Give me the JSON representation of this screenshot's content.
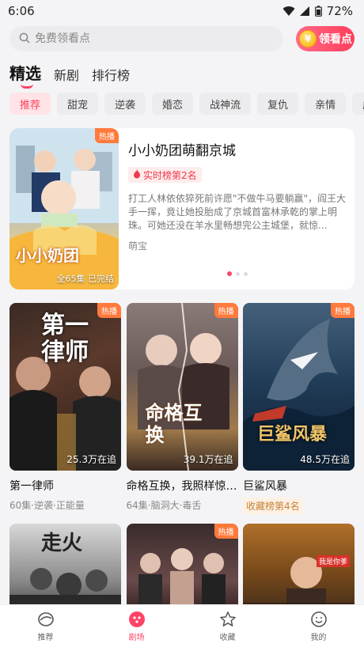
{
  "status_bar": {
    "time": "6:06",
    "battery": "72%"
  },
  "search": {
    "placeholder": "免费领看点",
    "watch_button": "领看点",
    "coin_symbol": "¥"
  },
  "main_tabs": [
    {
      "label": "精选"
    },
    {
      "label": "新剧"
    },
    {
      "label": "排行榜"
    }
  ],
  "chips": [
    "推荐",
    "甜宠",
    "逆袭",
    "婚恋",
    "战神流",
    "复仇",
    "亲情",
    "虐文"
  ],
  "hero": {
    "badge": "热播",
    "poster_caption": "全65集 已完结",
    "title": "小小奶团萌翻京城",
    "rank_tag": "实时榜第2名",
    "description": "打工人林依依猝死前许愿\"不做牛马要躺赢\"，阎王大手一挥，竟让她投胎成了京城首富林承乾的掌上明珠。可她还没在羊水里畅想完公主城堡，就惊...",
    "author": "萌宝",
    "poster_logo": "小小奶团"
  },
  "cards": [
    {
      "title": "第一律师",
      "meta": "60集·逆袭·正能量",
      "count": "25.3万在追",
      "badge": "热播",
      "poster_text": "第一律师"
    },
    {
      "title": "命格互换，我照样惊…",
      "meta": "64集·脑洞大·毒舌",
      "count": "39.1万在追",
      "badge": "热播",
      "poster_text": "命格互换"
    },
    {
      "title": "巨鲨风暴",
      "rank": "收藏榜第4名",
      "count": "48.5万在追",
      "badge": "热播",
      "poster_text": "巨鲨风暴"
    }
  ],
  "row2": [
    {
      "poster_text": "走火"
    },
    {
      "badge": "热播"
    },
    {
      "poster_text": "我是你爹"
    }
  ],
  "bottom_nav": [
    {
      "label": "推荐",
      "icon": "recommend-icon"
    },
    {
      "label": "剧场",
      "icon": "theater-icon"
    },
    {
      "label": "收藏",
      "icon": "star-icon"
    },
    {
      "label": "我的",
      "icon": "profile-icon"
    }
  ],
  "colors": {
    "accent": "#ff4466",
    "hot_badge": "#ff7a3c"
  }
}
